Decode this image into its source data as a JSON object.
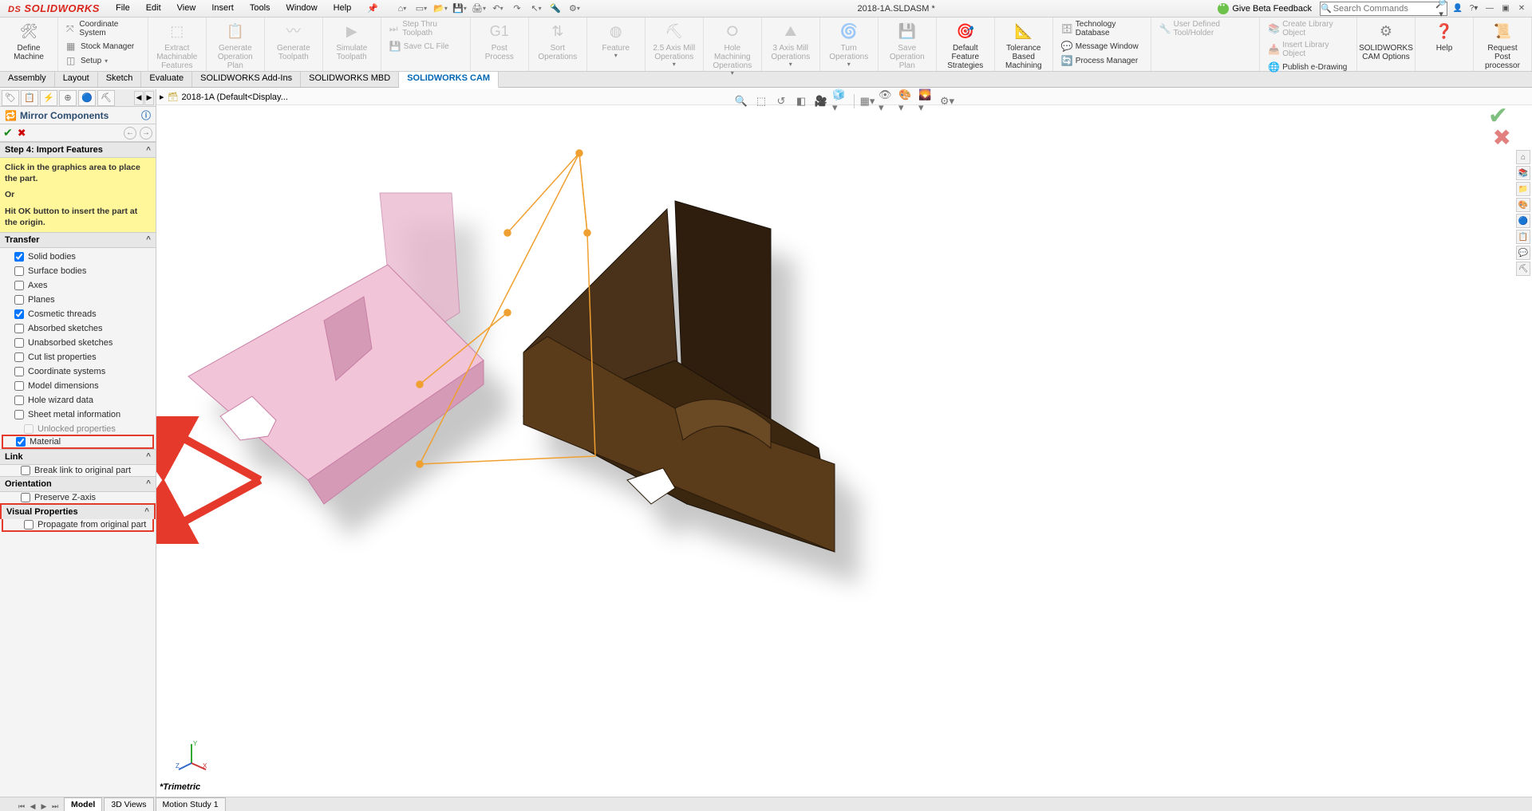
{
  "app": {
    "logo_prefix": "DS",
    "logo_main": "SOLIDWORKS"
  },
  "menu": [
    "File",
    "Edit",
    "View",
    "Insert",
    "Tools",
    "Window",
    "Help"
  ],
  "doc_title": "2018-1A.SLDASM *",
  "feedback_label": "Give Beta Feedback",
  "search_placeholder": "Search Commands",
  "ribbon": {
    "define_machine": "Define\nMachine",
    "coord_sys": "Coordinate System",
    "stock_mgr": "Stock Manager",
    "setup": "Setup",
    "extract": "Extract\nMachinable\nFeatures",
    "gen_op_plan": "Generate\nOperation\nPlan",
    "gen_tp": "Generate\nToolpath",
    "sim_tp": "Simulate\nToolpath",
    "step_thru": "Step Thru Toolpath",
    "save_cl": "Save CL File",
    "post": "Post\nProcess",
    "sort": "Sort\nOperations",
    "feature": "Feature",
    "mill25": "2.5 Axis\nMill\nOperations",
    "hole": "Hole\nMachining\nOperations",
    "mill3": "3 Axis Mill\nOperations",
    "turn": "Turn\nOperations",
    "save_op": "Save\nOperation\nPlan",
    "dfs": "Default\nFeature\nStrategies",
    "tbm": "Tolerance\nBased\nMachining",
    "tech_db": "Technology Database",
    "msg_win": "Message Window",
    "proc_mgr": "Process Manager",
    "user_tool": "User Defined Tool/Holder",
    "create_lib": "Create Library Object",
    "insert_lib": "Insert Library Object",
    "pub_ed": "Publish e-Drawing",
    "cam_opt": "SOLIDWORKS\nCAM Options",
    "help": "Help",
    "req_pp": "Request\nPost\nprocessor"
  },
  "tabs": [
    "Assembly",
    "Layout",
    "Sketch",
    "Evaluate",
    "SOLIDWORKS Add-Ins",
    "SOLIDWORKS MBD",
    "SOLIDWORKS CAM"
  ],
  "active_tab": "SOLIDWORKS CAM",
  "breadcrumb": "2018-1A  (Default<Display...",
  "pm": {
    "title": "Mirror Components",
    "step": "Step 4: Import Features",
    "note_l1": "Click in the graphics area to place the part.",
    "note_l2": "Or",
    "note_l3": "Hit OK button to insert the part at the origin.",
    "transfer_head": "Transfer",
    "transfer": [
      {
        "label": "Solid bodies",
        "checked": true
      },
      {
        "label": "Surface bodies",
        "checked": false
      },
      {
        "label": "Axes",
        "checked": false
      },
      {
        "label": "Planes",
        "checked": false
      },
      {
        "label": "Cosmetic threads",
        "checked": true
      },
      {
        "label": "Absorbed sketches",
        "checked": false
      },
      {
        "label": "Unabsorbed sketches",
        "checked": false
      },
      {
        "label": "Cut list properties",
        "checked": false
      },
      {
        "label": "Coordinate systems",
        "checked": false
      },
      {
        "label": "Model dimensions",
        "checked": false
      },
      {
        "label": "Hole wizard data",
        "checked": false
      },
      {
        "label": "Sheet metal information",
        "checked": false
      }
    ],
    "unlocked": "Unlocked properties",
    "material": {
      "label": "Material",
      "checked": true
    },
    "link_head": "Link",
    "link_item": {
      "label": "Break link to original part",
      "checked": false
    },
    "orient_head": "Orientation",
    "orient_item": {
      "label": "Preserve Z-axis",
      "checked": false
    },
    "vp_head": "Visual Properties",
    "vp_item": {
      "label": "Propagate from original part",
      "checked": false
    }
  },
  "orientation_label": "*Trimetric",
  "bottom_tabs": [
    "Model",
    "3D Views",
    "Motion Study 1"
  ]
}
